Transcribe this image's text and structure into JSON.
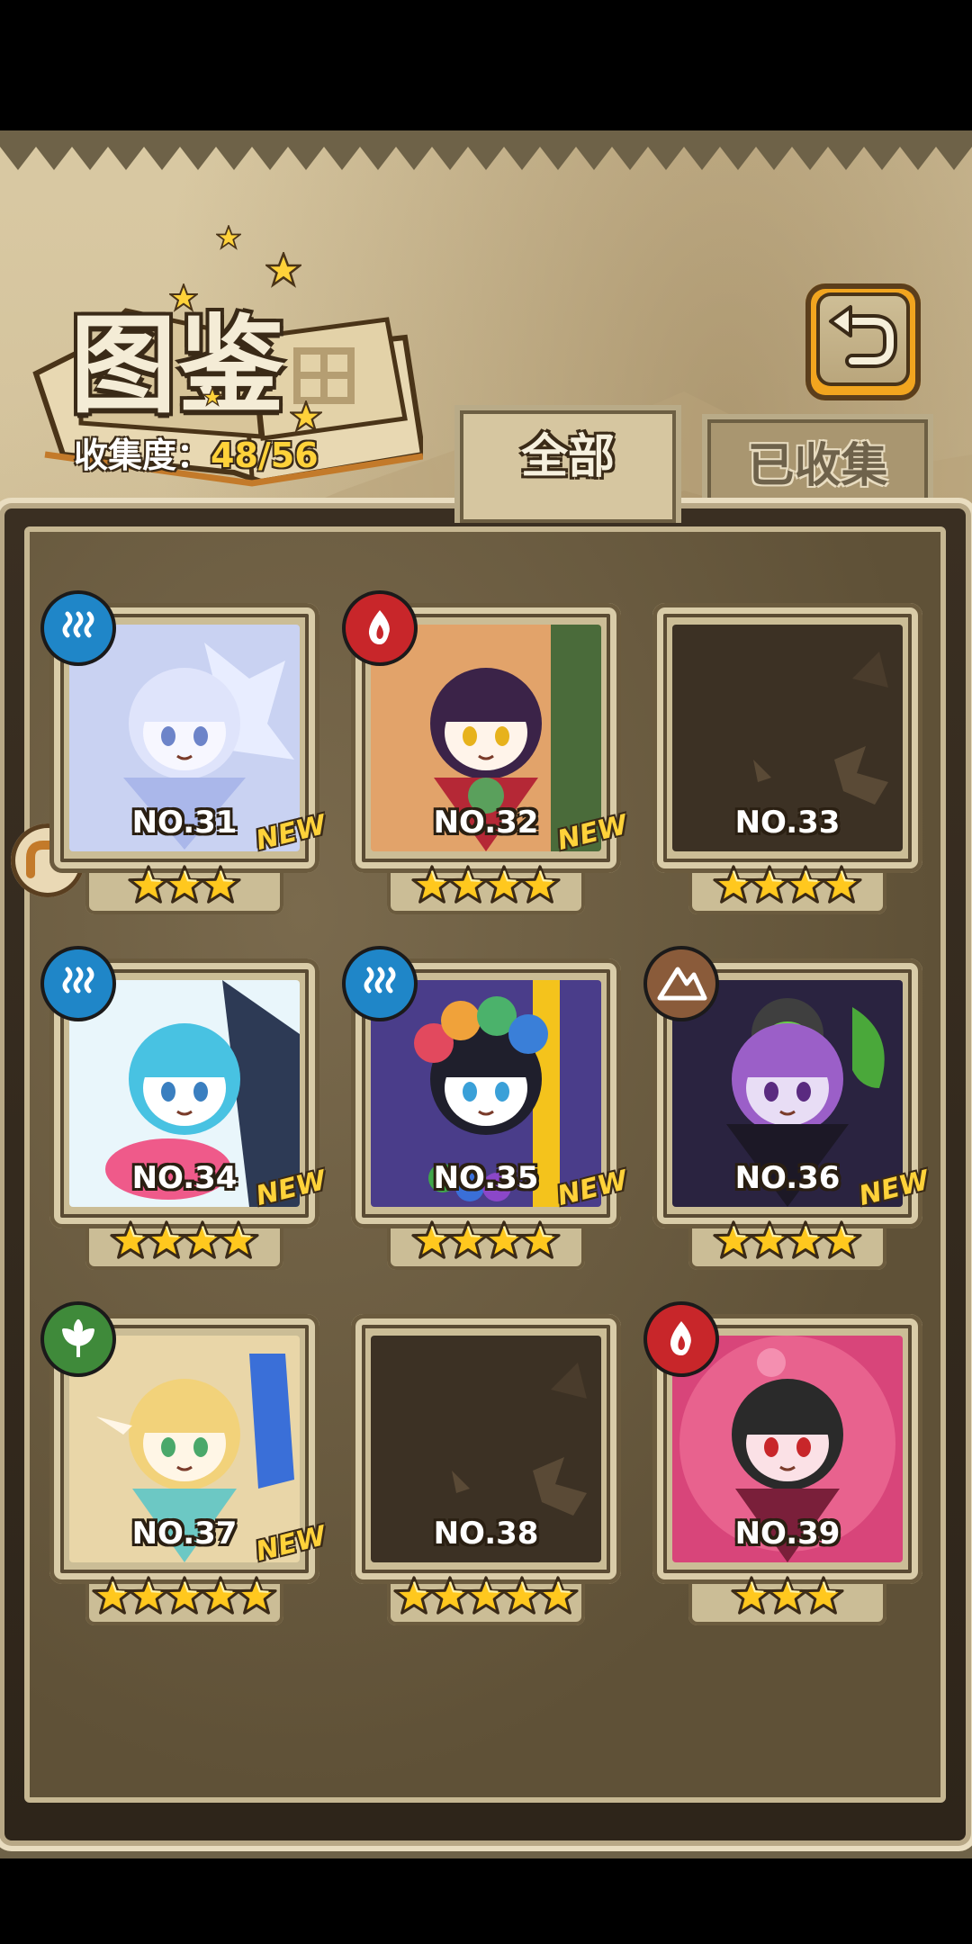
{
  "header": {
    "title": "图鉴",
    "progress_label": "收集度：",
    "progress_value": "48/56"
  },
  "tabs": [
    {
      "label": "全部",
      "active": true
    },
    {
      "label": "已收集",
      "active": false
    }
  ],
  "cards": [
    {
      "no": "NO.31",
      "stars": 3,
      "new": "NEW",
      "element": "water",
      "art": "ice"
    },
    {
      "no": "NO.32",
      "stars": 4,
      "new": "NEW",
      "element": "fire",
      "art": "kimono"
    },
    {
      "no": "NO.33",
      "stars": 4,
      "new": "",
      "element": "",
      "art": "locked"
    },
    {
      "no": "NO.34",
      "stars": 4,
      "new": "NEW",
      "element": "water",
      "art": "aqua"
    },
    {
      "no": "NO.35",
      "stars": 4,
      "new": "NEW",
      "element": "water",
      "art": "tribal"
    },
    {
      "no": "NO.36",
      "stars": 4,
      "new": "NEW",
      "element": "earth",
      "art": "dark"
    },
    {
      "no": "NO.37",
      "stars": 5,
      "new": "NEW",
      "element": "wood",
      "art": "elf"
    },
    {
      "no": "NO.38",
      "stars": 5,
      "new": "",
      "element": "",
      "art": "locked"
    },
    {
      "no": "NO.39",
      "stars": 3,
      "new": "",
      "element": "fire",
      "art": "flower"
    }
  ],
  "colors": {
    "water": "#1f86c8",
    "fire": "#c8262a",
    "earth": "#8a5b3a",
    "wood": "#3f8a3a",
    "gold": "#ffd23a",
    "back_button": "#f2a51f"
  },
  "icons": {
    "back": "return-arrow-icon",
    "side": "side-arrow-icon"
  }
}
